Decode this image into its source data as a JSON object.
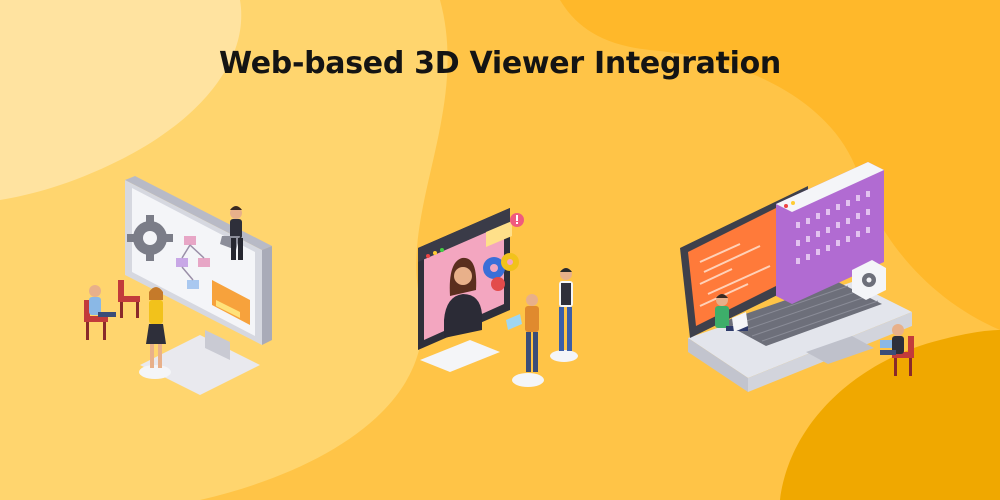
{
  "banner": {
    "title": "Web-based 3D Viewer Integration"
  },
  "colors": {
    "background": "#FFC447",
    "blob_light": "#FFD56E",
    "blob_pale": "#FFE3A0",
    "blob_dark": "#F0A800",
    "title_text": "#141414"
  },
  "illustrations": [
    {
      "name": "monitor-flowchart-team",
      "icons": [
        "gear-icon",
        "flowchart-icon"
      ]
    },
    {
      "name": "video-call-collaboration",
      "icons": [
        "gears-icon",
        "alert-icon"
      ]
    },
    {
      "name": "laptop-code-binary",
      "icons": [
        "gear-icon",
        "code-icon"
      ]
    }
  ]
}
